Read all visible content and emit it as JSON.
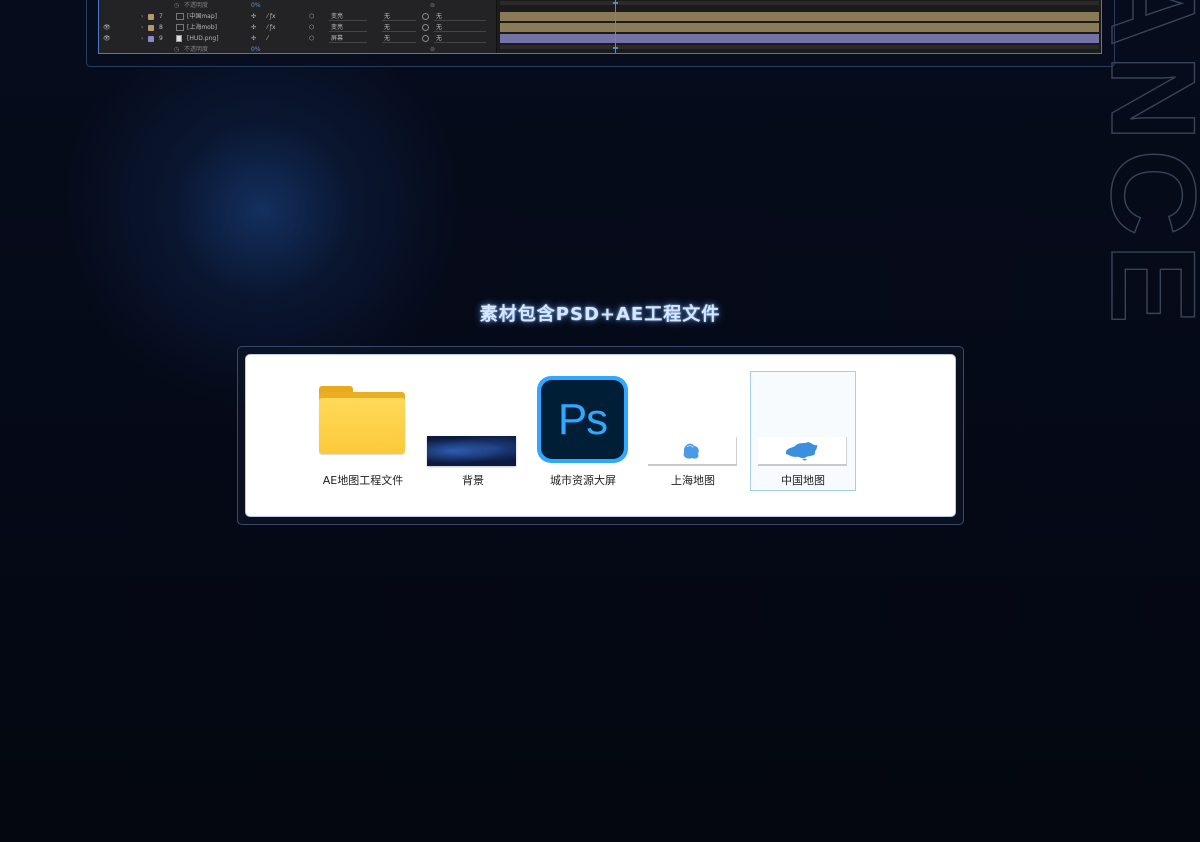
{
  "title": "素材包含PSD+AE工程文件",
  "side_text": "ANCE",
  "ae_layers": [
    {
      "index": "",
      "name": "不透明度",
      "mode": "",
      "percent": "0%",
      "sub": true
    },
    {
      "index": "7",
      "name": "[中国map]",
      "mode": "变亮",
      "trk": "无",
      "par": "无",
      "color": "#b59a67"
    },
    {
      "index": "8",
      "name": "[上海mob]",
      "mode": "变亮",
      "trk": "无",
      "par": "无",
      "color": "#b59a67"
    },
    {
      "index": "9",
      "name": "[HUD.png]",
      "mode": "屏幕",
      "trk": "无",
      "par": "无",
      "color": "#8a89d0"
    },
    {
      "index": "",
      "name": "不透明度",
      "mode": "",
      "percent": "0%",
      "sub": true
    }
  ],
  "files": [
    {
      "label": "AE地图工程文件",
      "icon": "folder-icon"
    },
    {
      "label": "背景",
      "icon": "image-thumbnail"
    },
    {
      "label": "城市资源大屏",
      "icon": "photoshop-icon"
    },
    {
      "label": "上海地图",
      "icon": "map-thumbnail"
    },
    {
      "label": "中国地图",
      "icon": "map-thumbnail",
      "selected": true
    }
  ],
  "ps_icon_text": "Ps",
  "colors": {
    "background": "#050915",
    "title_glow": "#6eaaff",
    "ae_selection": "#4a78c8",
    "folder": "#fcc93a",
    "ps_blue": "#31a8ff",
    "ps_dark": "#001e36",
    "map_blue": "#3b8fe0"
  }
}
